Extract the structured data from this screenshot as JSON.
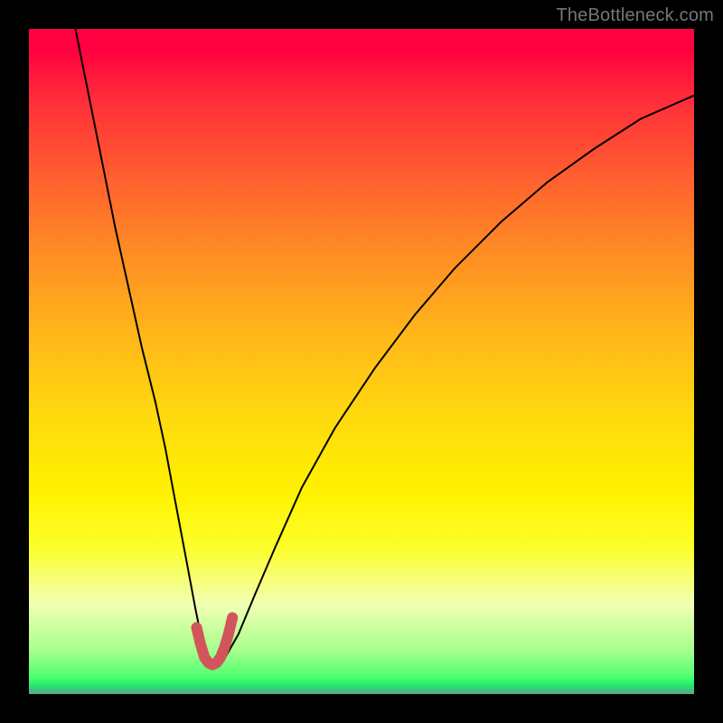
{
  "watermark": {
    "text": "TheBottleneck.com"
  },
  "chart_data": {
    "type": "line",
    "title": "",
    "xlabel": "",
    "ylabel": "",
    "xlim": [
      0,
      100
    ],
    "ylim": [
      0,
      100
    ],
    "grid": false,
    "legend": "none",
    "gradient_stops": [
      {
        "pos": 0,
        "color": "#ff0040"
      },
      {
        "pos": 0.22,
        "color": "#ff5e2f"
      },
      {
        "pos": 0.45,
        "color": "#ffb31a"
      },
      {
        "pos": 0.7,
        "color": "#fff200"
      },
      {
        "pos": 0.87,
        "color": "#f2ffb3"
      },
      {
        "pos": 0.97,
        "color": "#4cff6f"
      },
      {
        "pos": 1.0,
        "color": "#56a889"
      }
    ],
    "series": [
      {
        "name": "bottleneck-curve",
        "color": "#000000",
        "stroke_width": 2,
        "x": [
          7,
          9,
          11,
          13,
          15,
          17,
          19,
          20.5,
          22,
          23.5,
          25,
          26,
          27,
          28,
          29.5,
          31.5,
          34,
          37,
          41,
          46,
          52,
          58,
          64,
          71,
          78,
          85,
          92,
          100
        ],
        "values": [
          100,
          90,
          80,
          70,
          61,
          52,
          44,
          37,
          29,
          21,
          13,
          8,
          5,
          4.5,
          5.5,
          9,
          15,
          22,
          31,
          40,
          49,
          57,
          64,
          71,
          77,
          82,
          86.5,
          90
        ]
      },
      {
        "name": "trough-highlight",
        "color": "#d1555b",
        "stroke_width": 12,
        "linecap": "round",
        "x": [
          25.2,
          25.8,
          26.4,
          27.0,
          27.6,
          28.2,
          28.8,
          29.4,
          30.0,
          30.6
        ],
        "values": [
          10.0,
          7.5,
          5.5,
          4.7,
          4.4,
          4.7,
          5.5,
          7.0,
          9.0,
          11.5
        ]
      }
    ],
    "dip_position_x_percent": 28
  }
}
